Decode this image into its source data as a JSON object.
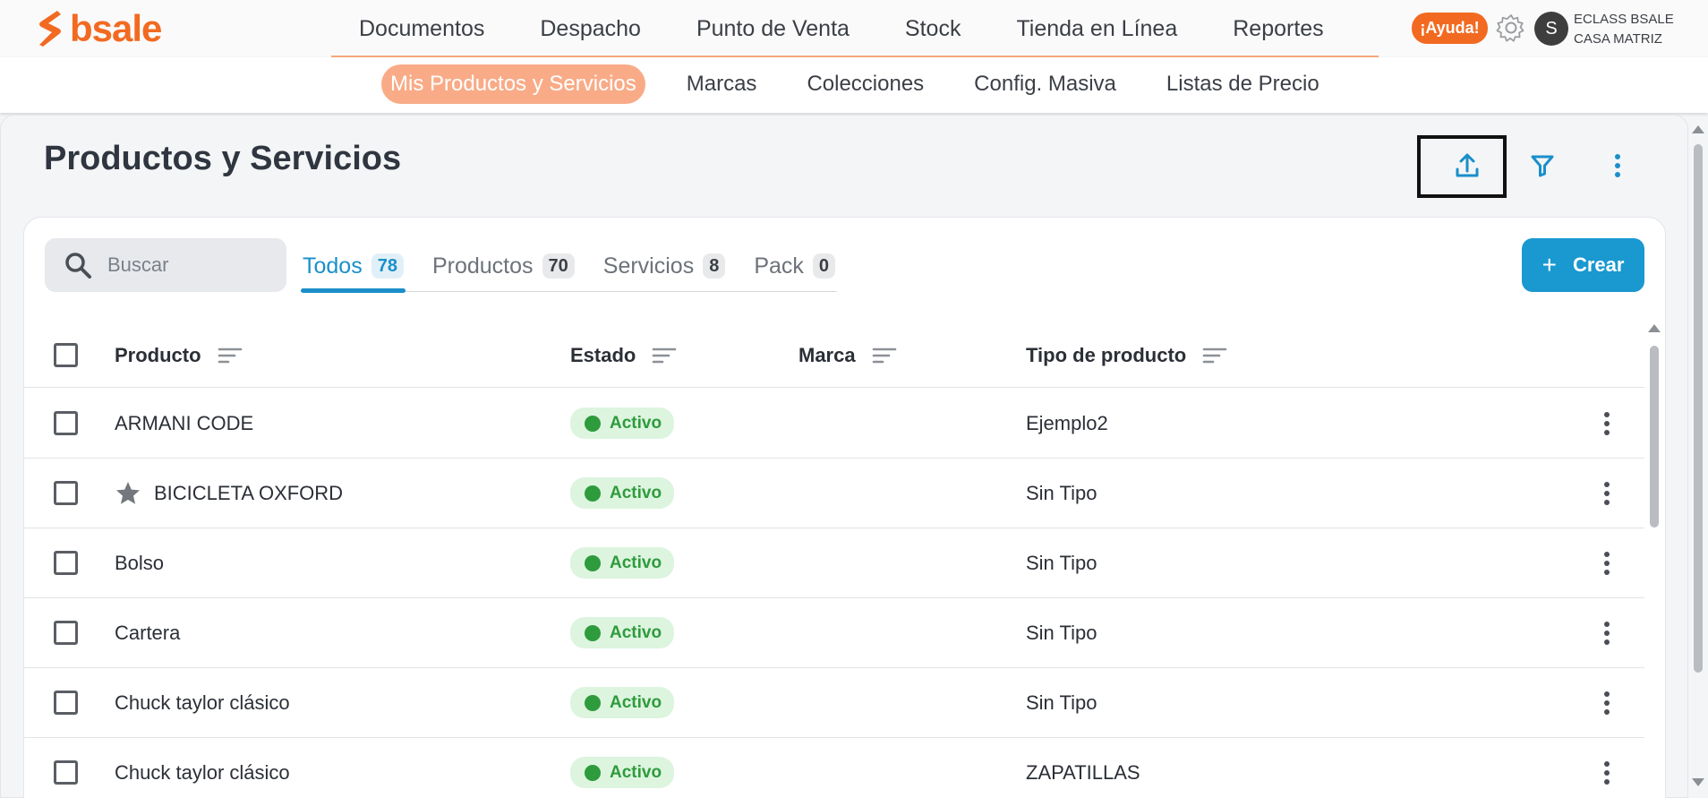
{
  "brand": {
    "name": "bsale",
    "color": "#f26a21"
  },
  "main_nav": [
    "Documentos",
    "Despacho",
    "Punto de Venta",
    "Stock",
    "Tienda en Línea",
    "Reportes"
  ],
  "header": {
    "help_label": "¡Ayuda!",
    "avatar_initial": "S",
    "account_line1": "ECLASS BSALE",
    "account_line2": "CASA MATRIZ"
  },
  "sub_nav": {
    "active": "Mis Productos y Servicios",
    "items": [
      "Marcas",
      "Colecciones",
      "Config. Masiva",
      "Listas de Precio"
    ]
  },
  "page": {
    "title": "Productos y Servicios"
  },
  "toolbar_icons": {
    "upload": "upload-icon",
    "filter": "filter-icon",
    "more": "more-vertical-icon"
  },
  "search": {
    "placeholder": "Buscar",
    "value": ""
  },
  "tabs": [
    {
      "label": "Todos",
      "count": "78",
      "active": true
    },
    {
      "label": "Productos",
      "count": "70"
    },
    {
      "label": "Servicios",
      "count": "8"
    },
    {
      "label": "Pack",
      "count": "0"
    }
  ],
  "create_button": {
    "label": "Crear",
    "color": "#1a98d0"
  },
  "table": {
    "columns": [
      "Producto",
      "Estado",
      "Marca",
      "Tipo de producto"
    ],
    "rows": [
      {
        "product": "ARMANI CODE",
        "starred": false,
        "status": "Activo",
        "brand": "",
        "type": "Ejemplo2"
      },
      {
        "product": "BICICLETA OXFORD",
        "starred": true,
        "status": "Activo",
        "brand": "",
        "type": "Sin Tipo"
      },
      {
        "product": "Bolso",
        "starred": false,
        "status": "Activo",
        "brand": "",
        "type": "Sin Tipo"
      },
      {
        "product": "Cartera",
        "starred": false,
        "status": "Activo",
        "brand": "",
        "type": "Sin Tipo"
      },
      {
        "product": "Chuck taylor clásico",
        "starred": false,
        "status": "Activo",
        "brand": "",
        "type": "Sin Tipo"
      },
      {
        "product": "Chuck taylor clásico",
        "starred": false,
        "status": "Activo",
        "brand": "",
        "type": "ZAPATILLAS"
      }
    ]
  },
  "colors": {
    "accent": "#1a8fc9",
    "status_active": "#2e9b3c",
    "status_active_bg": "#ddf4df",
    "nav_active_bg": "#f9ab87"
  }
}
